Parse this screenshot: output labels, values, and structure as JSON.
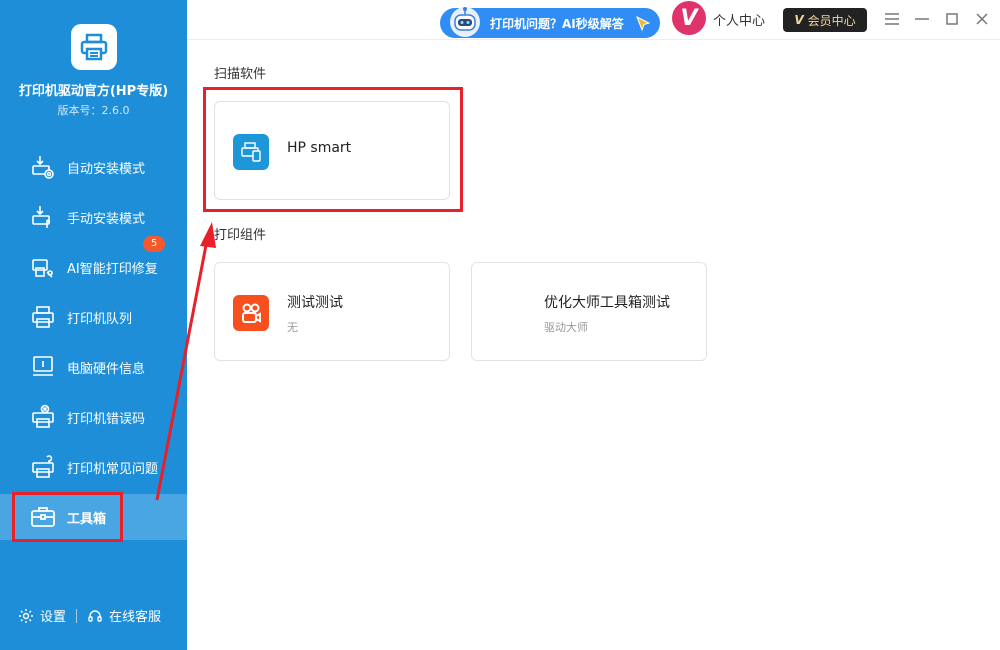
{
  "app": {
    "title": "打印机驱动官方(HP专版)",
    "version": "版本号：2.6.0"
  },
  "nav": {
    "items": [
      {
        "label": "自动安装模式",
        "icon": "auto-install-icon"
      },
      {
        "label": "手动安装模式",
        "icon": "manual-install-icon"
      },
      {
        "label": "AI智能打印修复",
        "icon": "ai-repair-icon",
        "badge": "5"
      },
      {
        "label": "打印机队列",
        "icon": "printer-queue-icon"
      },
      {
        "label": "电脑硬件信息",
        "icon": "hardware-info-icon"
      },
      {
        "label": "打印机错误码",
        "icon": "error-code-icon"
      },
      {
        "label": "打印机常见问题",
        "icon": "faq-icon"
      },
      {
        "label": "工具箱",
        "icon": "toolbox-icon",
        "active": true
      }
    ]
  },
  "footer": {
    "settings_label": "设置",
    "support_label": "在线客服"
  },
  "topbar": {
    "ai_text": "打印机问题？AI秒级解答",
    "personal_center": "个人中心",
    "vip_center": "会员中心"
  },
  "sections": {
    "scan_title": "扫描软件",
    "print_title": "打印组件"
  },
  "cards": {
    "hp_smart": {
      "title": "HP smart"
    },
    "test": {
      "title": "测试测试",
      "sub": "无"
    },
    "optimizer": {
      "title": "优化大师工具箱测试",
      "sub": "驱动大师"
    }
  },
  "colors": {
    "sidebar": "#1e8ed8",
    "active_item": "#4aa6e3",
    "highlight_red": "#e8202a",
    "badge": "#f5582c"
  }
}
